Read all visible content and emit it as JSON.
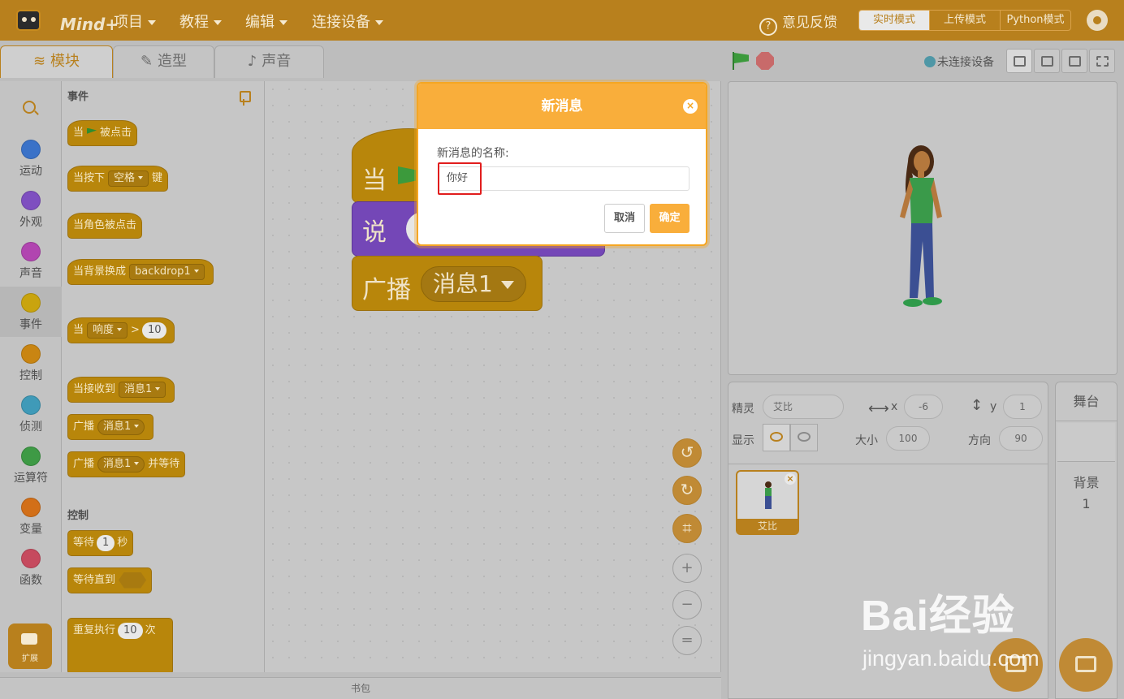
{
  "header": {
    "logo_text": "Mind+",
    "menu": [
      "项目",
      "教程",
      "编辑",
      "连接设备"
    ],
    "feedback": "意见反馈",
    "modes": [
      "实时模式",
      "上传模式",
      "Python模式"
    ]
  },
  "tabs": [
    "模块",
    "造型",
    "声音"
  ],
  "categories": [
    "运动",
    "外观",
    "声音",
    "事件",
    "控制",
    "侦测",
    "运算符",
    "变量",
    "函数"
  ],
  "category_colors": [
    "#3a72c8",
    "#7e4fc0",
    "#b145b0",
    "#c9a40e",
    "#c98512",
    "#3f9ab8",
    "#3e9a45",
    "#d26f18",
    "#c64a5e"
  ],
  "extension_label": "扩展",
  "palette": {
    "events_title": "事件",
    "control_title": "控制",
    "b_when": "当",
    "b_flag_clicked": "被点击",
    "b_when_key": "当按下",
    "b_space": "空格",
    "b_key": "键",
    "b_sprite_clicked": "当角色被点击",
    "b_backdrop_switch": "当背景换成",
    "b_backdrop1": "backdrop1",
    "b_loudness": "响度",
    "b_gt": ">",
    "b_ten": "10",
    "b_when_receive": "当接收到",
    "b_msg1": "消息1",
    "b_broadcast": "广播",
    "b_and_wait": "并等待",
    "b_wait": "等待",
    "b_one": "1",
    "b_sec": "秒",
    "b_wait_until": "等待直到",
    "b_repeat": "重复执行",
    "b_times": "次"
  },
  "workspace": {
    "when": "当",
    "say": "说",
    "broadcast": "广播",
    "message": "消息1"
  },
  "backpack": "书包",
  "stage_bar": {
    "device_status": "未连接设备"
  },
  "sprite_info": {
    "sprite_label": "精灵",
    "sprite_name": "艾比",
    "x_label": "x",
    "x_value": "-6",
    "y_label": "y",
    "y_value": "1",
    "show_label": "显示",
    "size_label": "大小",
    "size_value": "100",
    "direction_label": "方向",
    "direction_value": "90",
    "thumb_name": "艾比"
  },
  "stage_panel": {
    "title": "舞台",
    "backdrop_label": "背景",
    "backdrop_count": "1"
  },
  "dialog": {
    "title": "新消息",
    "prompt": "新消息的名称:",
    "input_value": "你好",
    "cancel": "取消",
    "ok": "确定"
  },
  "watermark": {
    "main": "Bai经验",
    "sub": "jingyan.baidu.com"
  }
}
